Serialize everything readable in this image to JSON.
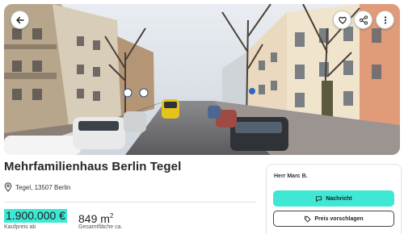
{
  "listing": {
    "title": "Mehrfamilienhaus Berlin Tegel",
    "location": "Tegel, 13507 Berlin",
    "price": "1.900.000 €",
    "price_label": "Kaufpreis ab",
    "area_value": "849 m",
    "area_unit_sup": "2",
    "area_label": "Gesamtfläche ca."
  },
  "contact": {
    "name": "Herr Marc B.",
    "message_label": "Nachricht",
    "offer_label": "Preis vorschlagen"
  },
  "icons": {
    "back": "arrow-left-icon",
    "favorite": "heart-icon",
    "share": "share-icon",
    "more": "more-vertical-icon",
    "location": "location-pin-icon",
    "message": "chat-bubble-icon",
    "offer": "price-tag-icon"
  },
  "colors": {
    "accent": "#3ee8d4",
    "text": "#1e1e1e"
  }
}
